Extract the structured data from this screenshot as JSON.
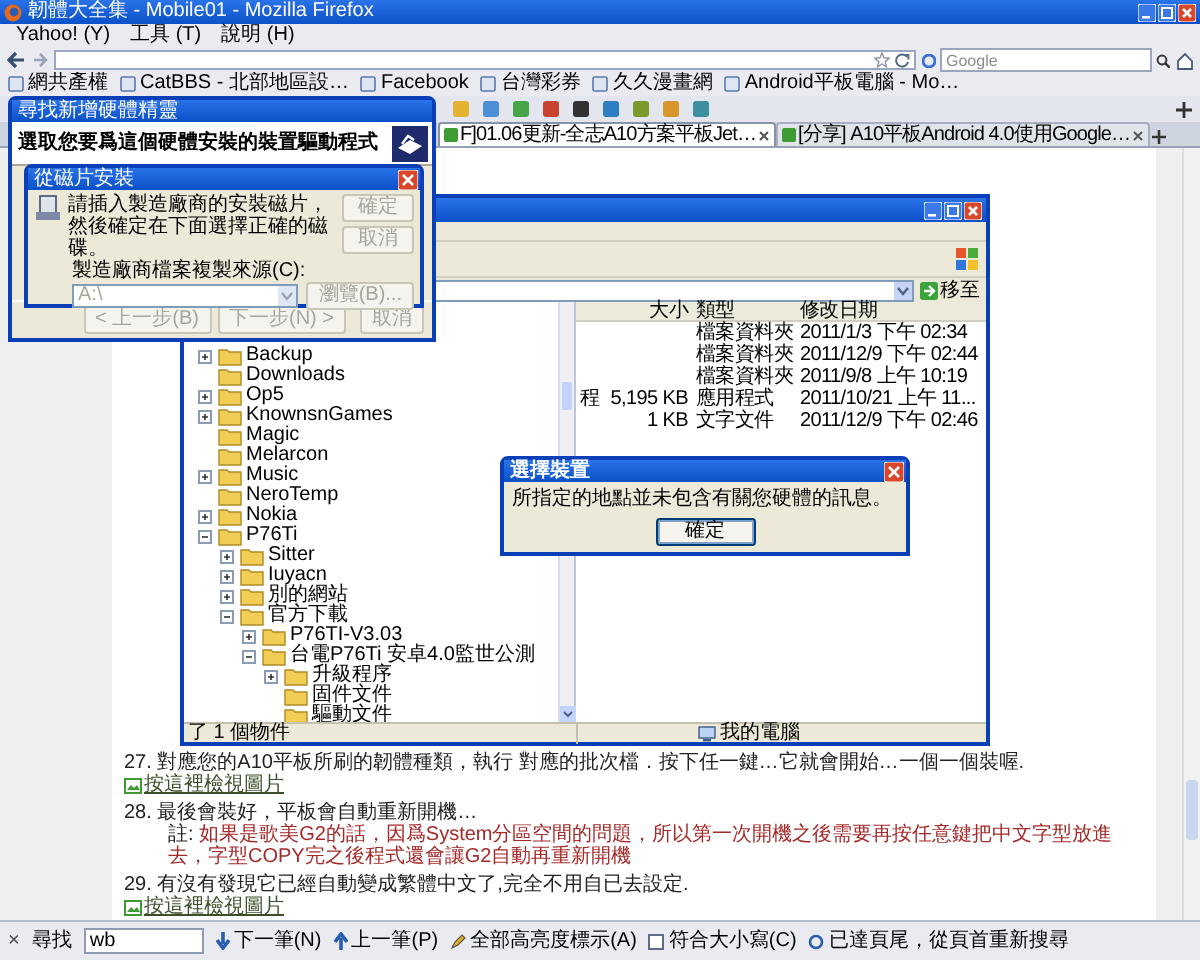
{
  "window": {
    "title": "韌體大全集 - Mobile01 - Mozilla Firefox"
  },
  "menu": [
    "Yahoo! (Y)",
    "工具 (T)",
    "說明 (H)"
  ],
  "search": {
    "placeholder": "Google"
  },
  "bookmarks": [
    "網共產權",
    "CatBBS - 北部地區設…",
    "Facebook",
    "台灣彩券",
    "久久漫畫網",
    "Android平板電腦 - Mo…"
  ],
  "tabs": [
    {
      "label": "F]01.06更新-全志A10方案平板Jet…",
      "selected": true
    },
    {
      "label": "[分享] A10平板Android 4.0使用Google…",
      "selected": false
    }
  ],
  "page": {
    "blocks": [
      {
        "kind": "step",
        "text": "27. 對應您的A10平板所刷的韌體種類，執行 對應的批次檔．按下任一鍵…它就會開始…一個一個裝喔."
      },
      {
        "kind": "link",
        "text": "按這裡檢視圖片"
      },
      {
        "kind": "step",
        "text": "28. 最後會裝好，平板會自動重新開機…"
      },
      {
        "kind": "note",
        "label": "註: ",
        "text": "如果是歌美G2的話，因爲System分區空間的問題，所以第一次開機之後需要再按任意鍵把中文字型放進去，字型COPY完之後程式還會讓G2自動再重新開機"
      },
      {
        "kind": "step",
        "text": "29. 有沒有發現它已經自動變成繁體中文了,完全不用自已去設定."
      },
      {
        "kind": "link",
        "text": "按這裡檢視圖片"
      }
    ]
  },
  "find_bar": {
    "close": "×",
    "label": "尋找",
    "value": "wb",
    "next": "下一筆(N)",
    "previous": "上一筆(P)",
    "highlight": "全部高亮度標示(A)",
    "match_case": {
      "label": "符合大小寫(C)",
      "checked": false
    },
    "status": "已達頁尾，從頁首重新搜尋"
  },
  "explorer": {
    "go_button": "移至",
    "columns": [
      "大小",
      "類型",
      "修改日期"
    ],
    "rows": [
      {
        "type": "檔案資料夾",
        "modified": "2011/1/3 下午 02:34"
      },
      {
        "type": "檔案資料夾",
        "modified": "2011/12/9 下午 02:44"
      },
      {
        "type": "檔案資料夾",
        "modified": "2011/9/8 上午 10:19"
      },
      {
        "name": "程",
        "size": "5,195 KB",
        "type": "應用程式",
        "modified": "2011/10/21 上午 11..."
      },
      {
        "size": "1 KB",
        "type": "文字文件",
        "modified": "2011/12/9 下午 02:46"
      }
    ],
    "tree": [
      {
        "label": "Backup",
        "kind": "collapsed"
      },
      {
        "label": "Downloads",
        "kind": "leaf"
      },
      {
        "label": "Op5",
        "kind": "collapsed"
      },
      {
        "label": "KnownsnGames",
        "kind": "collapsed"
      },
      {
        "label": "Magic",
        "kind": "leaf"
      },
      {
        "label": "Melarcon",
        "kind": "leaf"
      },
      {
        "label": "Music",
        "kind": "collapsed"
      },
      {
        "label": "NeroTemp",
        "kind": "leaf"
      },
      {
        "label": "Nokia",
        "kind": "collapsed"
      },
      {
        "label": "P76Ti",
        "kind": "expanded",
        "children": [
          {
            "label": "Sitter",
            "kind": "collapsed"
          },
          {
            "label": "Iuyacn",
            "kind": "collapsed"
          },
          {
            "label": "別的網站",
            "kind": "collapsed"
          },
          {
            "label": "官方下載",
            "kind": "expanded",
            "children": [
              {
                "label": "P76TI-V3.03",
                "kind": "collapsed"
              },
              {
                "label": "台電P76Ti 安卓4.0監世公測",
                "kind": "expanded",
                "children": [
                  {
                    "label": "升級程序",
                    "kind": "collapsed"
                  },
                  {
                    "label": "固件文件",
                    "kind": "leaf"
                  },
                  {
                    "label": "驅動文件",
                    "kind": "leaf"
                  }
                ]
              }
            ]
          }
        ]
      }
    ],
    "status_left": "了 1 個物件",
    "status_right": "我的電腦"
  },
  "wizard": {
    "title": "尋找新增硬體精靈",
    "heading": "選取您要爲這個硬體安裝的裝置驅動程式",
    "buttons": [
      {
        "label": "< 上一步(B)",
        "disabled": true
      },
      {
        "label": "下一步(N) >",
        "disabled": true
      },
      {
        "label": "取消",
        "disabled": true
      }
    ]
  },
  "disk_dialog": {
    "title": "從磁片安裝",
    "message": "請插入製造廠商的安裝磁片，然後確定在下面選擇正確的磁碟。",
    "buttons": [
      {
        "label": "確定",
        "disabled": true
      },
      {
        "label": "取消",
        "disabled": true
      }
    ],
    "source_label": "製造廠商檔案複製來源(C):",
    "source_value": "A:\\",
    "browse": {
      "label": "瀏覽(B)...",
      "disabled": true
    }
  },
  "message_box": {
    "title": "選擇裝置",
    "message": "所指定的地點並未包含有關您硬體的訊息。",
    "button": "確定"
  }
}
